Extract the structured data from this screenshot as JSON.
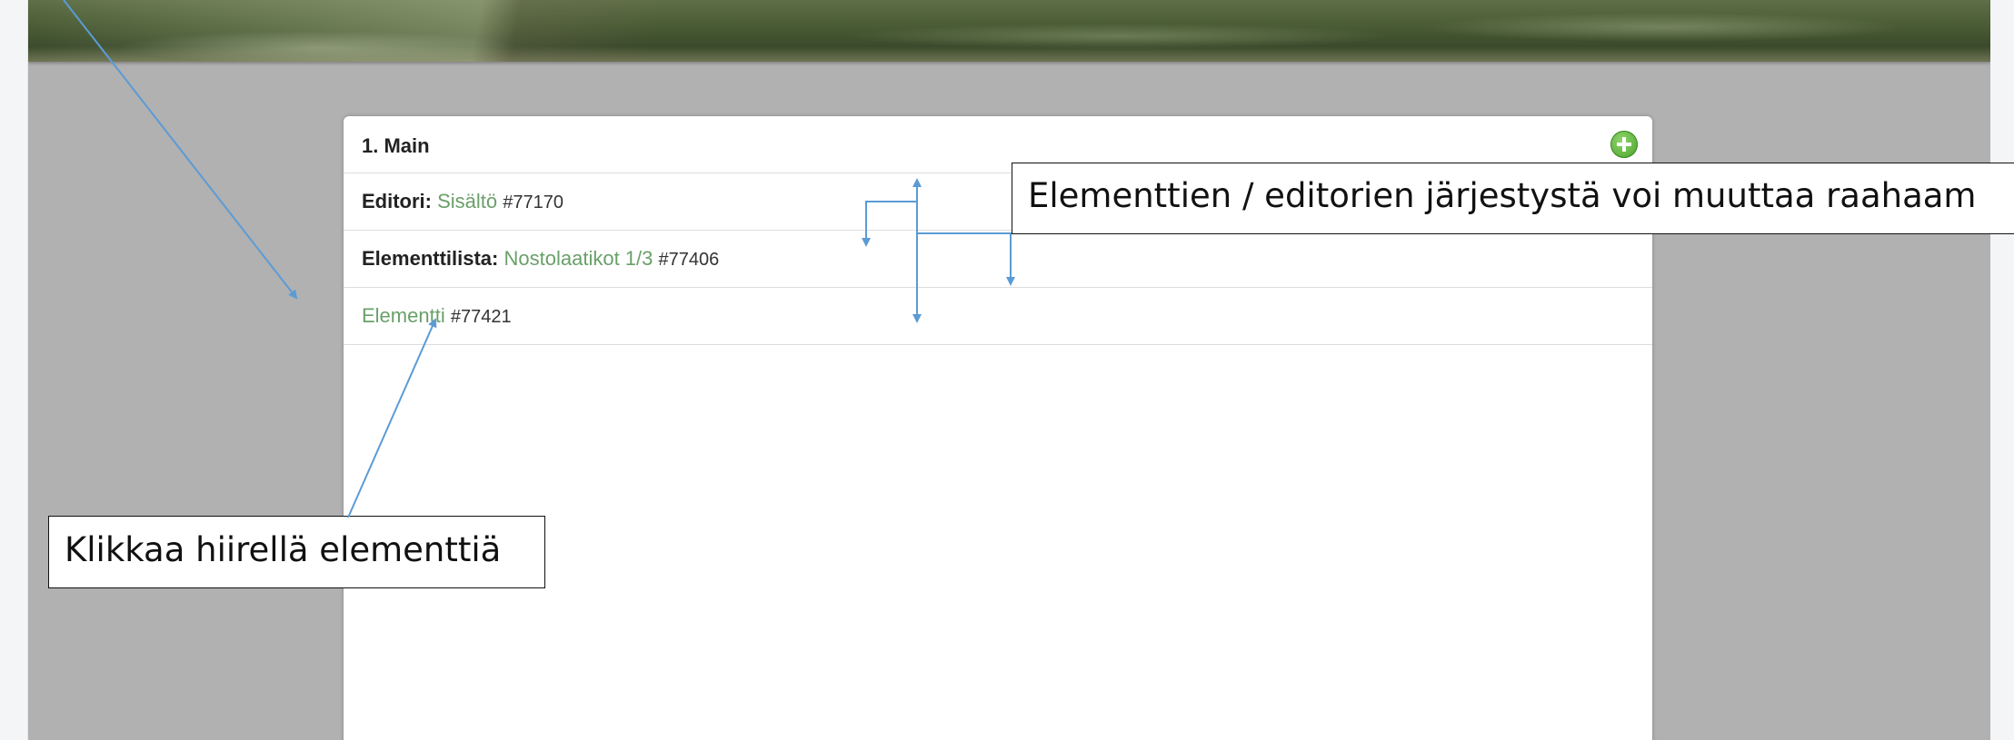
{
  "panel": {
    "title": "1. Main",
    "rows": [
      {
        "type": "Editori:",
        "name": "Sisältö",
        "id": "#77170"
      },
      {
        "type": "Elementtilista:",
        "name": "Nostolaatikot 1/3",
        "id": "#77406"
      },
      {
        "type": "",
        "name": "Elementti",
        "id": "#77421"
      }
    ]
  },
  "annotations": {
    "reorder_note": "Elementtien / editorien järjestystä voi muuttaa raahaam",
    "click_note": "Klikkaa hiirellä elementtiä"
  },
  "colors": {
    "link_green": "#6aa06a",
    "annotation_arrow": "#5b9bd5",
    "backdrop_gray": "#b1b1b1",
    "add_button_green": "#49a22a"
  }
}
